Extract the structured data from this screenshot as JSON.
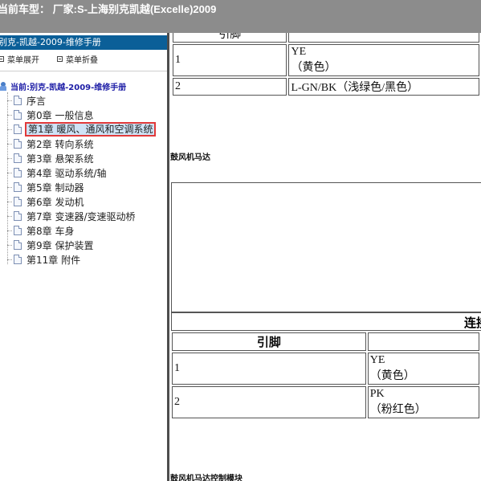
{
  "topbar": {
    "text": "当前车型：  厂家:S-上海别克凯越(Excelle)2009"
  },
  "sidebar": {
    "manual_title": "别克-凯越-2009-维修手册",
    "expand_label": "菜单展开",
    "collapse_label": "菜单折叠",
    "root_label": "当前:别克-凯越-2009-维修手册",
    "items": [
      {
        "label": "序言"
      },
      {
        "label": "第0章 一般信息"
      },
      {
        "label": "第1章 暖风、通风和空调系统",
        "selected": true
      },
      {
        "label": "第2章 转向系统"
      },
      {
        "label": "第3章 悬架系统"
      },
      {
        "label": "第4章 驱动系统/轴"
      },
      {
        "label": "第5章 制动器"
      },
      {
        "label": "第6章 发动机"
      },
      {
        "label": "第7章 变速器/变速驱动桥"
      },
      {
        "label": "第8章 车身"
      },
      {
        "label": "第9章 保护装置"
      },
      {
        "label": "第11章 附件"
      }
    ]
  },
  "content": {
    "table1": {
      "header": "引脚",
      "rows": [
        {
          "pin": "1",
          "color_code": "YE",
          "color_name": "（黄色）"
        },
        {
          "pin": "2",
          "color": "L-GN/BK（浅绿色/黑色）"
        }
      ]
    },
    "figure1_label": "鼓风机马达",
    "connector_label": "连接",
    "table2": {
      "header": "引脚",
      "rows": [
        {
          "pin": "1",
          "color_code": "YE",
          "color_name": "（黄色）"
        },
        {
          "pin": "2",
          "color_code": "PK",
          "color_name": "（粉红色）"
        }
      ]
    },
    "figure2_label": "鼓风机马达控制模块"
  },
  "colors": {
    "topbar_bg": "#8c8c8c",
    "sidebar_title_bg": "#0b5f98",
    "selection_border": "#e13a3a",
    "root_text": "#1c1ca6"
  }
}
